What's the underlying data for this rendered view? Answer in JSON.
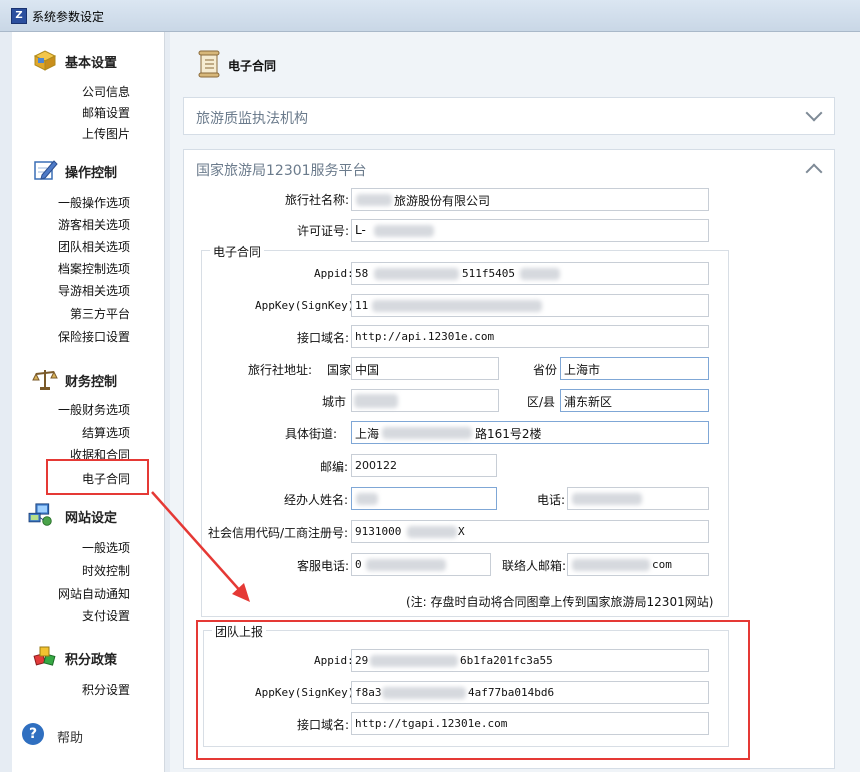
{
  "window": {
    "title": "系统参数设定",
    "icon": "app-icon"
  },
  "sidebar": {
    "sections": [
      {
        "label": "基本设置",
        "icon": "box-icon",
        "items": [
          "公司信息",
          "邮箱设置",
          "上传图片"
        ]
      },
      {
        "label": "操作控制",
        "icon": "pencil-edit-icon",
        "items": [
          "一般操作选项",
          "游客相关选项",
          "团队相关选项",
          "档案控制选项",
          "导游相关选项",
          "第三方平台",
          "保险接口设置"
        ]
      },
      {
        "label": "财务控制",
        "icon": "balance-scale-icon",
        "items": [
          "一般财务选项",
          "结算选项",
          "收据和合同",
          "电子合同"
        ]
      },
      {
        "label": "网站设定",
        "icon": "network-computer-icon",
        "items": [
          "一般选项",
          "时效控制",
          "网站自动通知",
          "支付设置"
        ]
      },
      {
        "label": "积分政策",
        "icon": "cubes-icon",
        "items": [
          "积分设置"
        ]
      }
    ],
    "help": {
      "label": "帮助",
      "icon": "help-icon"
    },
    "highlighted": "电子合同"
  },
  "main": {
    "header": {
      "label": "电子合同",
      "icon": "scroll-document-icon"
    },
    "panel1": {
      "title": "旅游质监执法机构",
      "icon": "chevron-down-icon"
    },
    "panel2": {
      "title": "国家旅游局12301服务平台",
      "icon": "chevron-up-icon",
      "agency_name_label": "旅行社名称:",
      "agency_name_value": "旅游股份有限公司",
      "license_label": "许可证号:",
      "license_value": "L-",
      "econtract": {
        "group_title": "电子合同",
        "appid_label": "Appid:",
        "appid_value": "58",
        "appid_value_mid": "511f5405",
        "appkey_label": "AppKey(SignKey):",
        "appkey_value": "11",
        "domain_label": "接口域名:",
        "domain_value": "http://api.12301e.com",
        "address_label": "旅行社地址:",
        "country_label": "国家",
        "country_value": "中国",
        "province_label": "省份",
        "province_value": "上海市",
        "city_label": "城市",
        "district_label": "区/县",
        "district_value": "浦东新区",
        "street_label": "具体街道:",
        "street_value_prefix": "上海",
        "street_value_suffix": "路161号2楼",
        "zip_label": "邮编:",
        "zip_value": "200122",
        "handler_label": "经办人姓名:",
        "phone_label": "电话:",
        "credit_label": "社会信用代码/工商注册号:",
        "credit_value_prefix": "9131000",
        "credit_value_suffix": "X",
        "service_label": "客服电话:",
        "service_value": "0",
        "email_label": "联络人邮箱:",
        "email_value": "com",
        "note": "(注: 存盘时自动将合同图章上传到国家旅游局12301网站)"
      },
      "team": {
        "group_title": "团队上报",
        "appid_label": "Appid:",
        "appid_value_prefix": "29",
        "appid_value_suffix": "6b1fa201fc3a55",
        "appkey_label": "AppKey(SignKey):",
        "appkey_value_prefix": "f8a3",
        "appkey_value_suffix": "4af77ba014bd6",
        "domain_label": "接口域名:",
        "domain_value": "http://tgapi.12301e.com"
      }
    }
  }
}
